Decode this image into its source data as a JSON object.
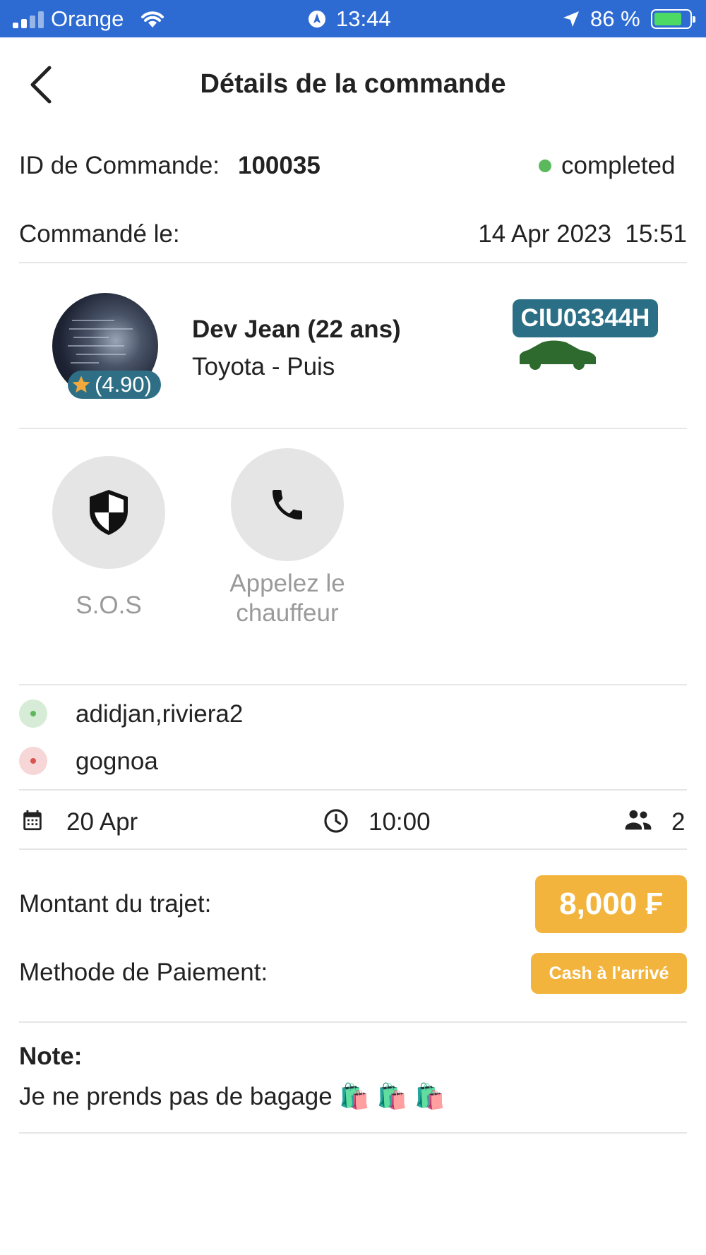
{
  "status_bar": {
    "carrier": "Orange",
    "time": "13:44",
    "battery": "86 %"
  },
  "header": {
    "title": "Détails de la commande"
  },
  "order": {
    "id_label": "ID de Commande:",
    "id_value": "100035",
    "status": "completed",
    "date_label": "Commandé le:",
    "date_value": "14 Apr 2023  15:51"
  },
  "driver": {
    "name": "Dev Jean (22 ans)",
    "car": "Toyota - Puis",
    "rating": "(4.90)",
    "plate": "CIU03344H"
  },
  "actions": {
    "sos_label": "S.O.S",
    "call_label_line1": "Appelez le",
    "call_label_line2": "chauffeur"
  },
  "route": {
    "pickup": "adidjan,riviera2",
    "dropoff": "gognoa"
  },
  "trip": {
    "date": "20 Apr",
    "time": "10:00",
    "passengers": "2"
  },
  "payment": {
    "amount_label": "Montant du trajet:",
    "amount_value": "8,000 ₣",
    "method_label": "Methode de Paiement:",
    "method_value": "Cash à l'arrivé"
  },
  "note": {
    "label": "Note:",
    "text": "Je ne prends pas de bagage 🛍️ 🛍️ 🛍️"
  },
  "colors": {
    "status_bar": "#2d6bd3",
    "accent": "#f2b43d",
    "plate": "#2a6f85",
    "status_dot": "#5cb85c"
  }
}
